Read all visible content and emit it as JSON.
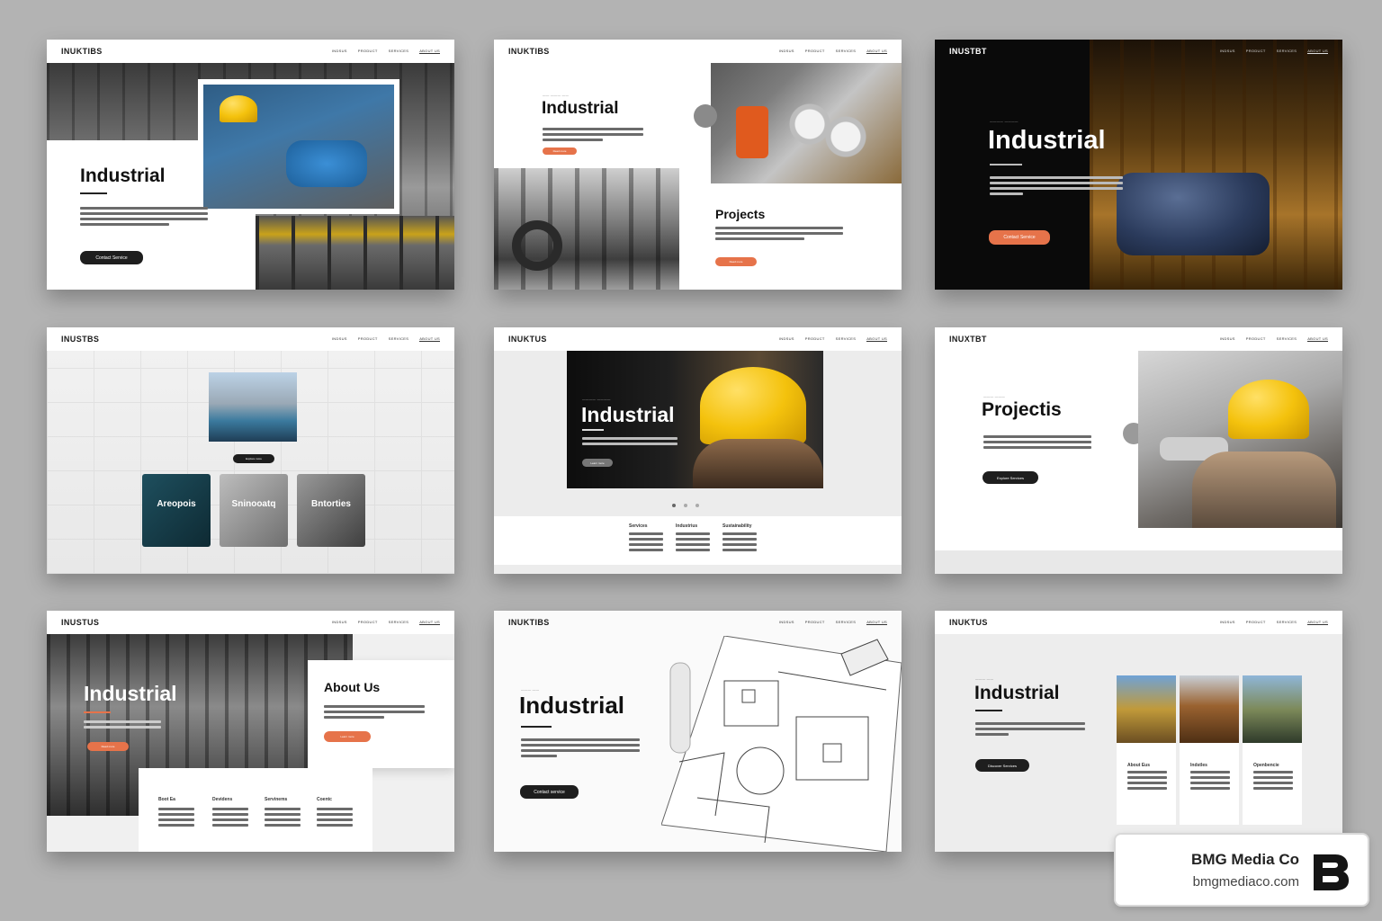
{
  "mockups": [
    {
      "logo": "INUKTIBS",
      "nav": [
        "INDSUS",
        "PRODUCT",
        "SERVICES",
        "ABOUT US"
      ],
      "title": "Industrial",
      "cta": "Contact Service"
    },
    {
      "logo": "INUKTIBS",
      "nav": [
        "INDSUS",
        "PRODUCT",
        "SERVICES",
        "ABOUT US"
      ],
      "title": "Industrial",
      "subtitle": "Projects",
      "cta": "Read more",
      "cta2": "Read more"
    },
    {
      "logo": "INUSTBT",
      "nav": [
        "INDSUS",
        "PRODUCT",
        "SERVICES",
        "ABOUT US"
      ],
      "title": "Industrial",
      "cta": "Contact Service"
    },
    {
      "logo": "INUSTBS",
      "nav": [
        "INDSUS",
        "PRODUCT",
        "SERVICES",
        "ABOUT US"
      ],
      "cta": "Explore more",
      "tiles": [
        "Areopois",
        "Sninooatq",
        "Bntorties"
      ]
    },
    {
      "logo": "INUKTUS",
      "nav": [
        "INDSUS",
        "PRODUCT",
        "SERVICES",
        "ABOUT US"
      ],
      "title": "Industrial",
      "cta": "Learn more",
      "columns": [
        "Services",
        "Industrius",
        "Sustainability"
      ]
    },
    {
      "logo": "INUXTBT",
      "nav": [
        "INDSUS",
        "PRODUCT",
        "SERVICES",
        "ABOUT US"
      ],
      "title": "Projectis",
      "cta": "Explore Services"
    },
    {
      "logo": "INUSTUS",
      "nav": [
        "INDSUS",
        "PRODUCT",
        "SERVICES",
        "ABOUT US"
      ],
      "title": "Industrial",
      "subtitle": "About Us",
      "cta": "Read more",
      "cta2": "Learn more",
      "columns": [
        "Boot Ea",
        "Devidens",
        "Servinems",
        "Coentc"
      ]
    },
    {
      "logo": "INUKTIBS",
      "nav": [
        "INDSUS",
        "PRODUCT",
        "SERVICES",
        "ABOUT US"
      ],
      "title": "Industrial",
      "cta": "Contact service"
    },
    {
      "logo": "INUKTUS",
      "nav": [
        "INDSUS",
        "PRODUCT",
        "SERVICES",
        "ABOUT US"
      ],
      "title": "Industrial",
      "cta": "Discover Services",
      "columns": [
        "About Eus",
        "Indstles",
        "Openbencie"
      ]
    }
  ],
  "badge": {
    "name": "BMG Media Co",
    "url": "bmgmediaco.com",
    "icon": "bmg-logo-icon"
  }
}
